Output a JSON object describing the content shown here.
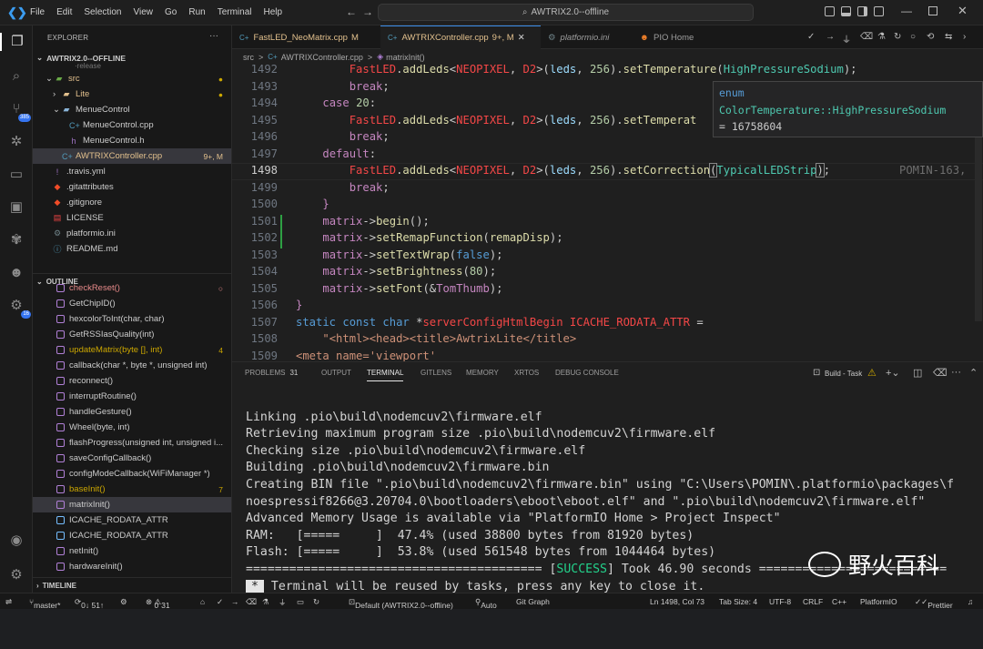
{
  "titlebar": {
    "menu": [
      "File",
      "Edit",
      "Selection",
      "View",
      "Go",
      "Run",
      "Terminal",
      "Help"
    ],
    "search": "AWTRIX2.0--offline"
  },
  "activity": {
    "scm_badge": "385",
    "ext_badge": "16"
  },
  "sidebar": {
    "explorer_title": "EXPLORER",
    "project": "AWTRIX2.0--OFFLINE",
    "items": [
      {
        "label": "src",
        "type": "folder",
        "dot": true
      },
      {
        "label": "Lite",
        "type": "folder",
        "dot": true
      },
      {
        "label": "MenueControl",
        "type": "folder"
      },
      {
        "label": "MenueControl.cpp",
        "type": "cpp"
      },
      {
        "label": "MenueControl.h",
        "type": "h"
      },
      {
        "label": "AWTRIXController.cpp",
        "type": "cpp",
        "decoration": "9+, M"
      },
      {
        "label": ".travis.yml",
        "type": "yml"
      },
      {
        "label": ".gitattributes",
        "type": "git"
      },
      {
        "label": ".gitignore",
        "type": "git"
      },
      {
        "label": "LICENSE",
        "type": "lic"
      },
      {
        "label": "platformio.ini",
        "type": "ini"
      },
      {
        "label": "README.md",
        "type": "md"
      }
    ],
    "outline_title": "OUTLINE",
    "outline": [
      {
        "label": "checkReset()",
        "decoration": "",
        "color": "#e88a8a"
      },
      {
        "label": "GetChipID()",
        "decoration": ""
      },
      {
        "label": "hexcolorToInt(char, char)",
        "decoration": ""
      },
      {
        "label": "GetRSSIasQuality(int)",
        "decoration": ""
      },
      {
        "label": "updateMatrix(byte [], int)",
        "decoration": "4",
        "color": "#cca700"
      },
      {
        "label": "callback(char *, byte *, unsigned int)",
        "decoration": ""
      },
      {
        "label": "reconnect()",
        "decoration": ""
      },
      {
        "label": "interruptRoutine()",
        "decoration": ""
      },
      {
        "label": "handleGesture()",
        "decoration": ""
      },
      {
        "label": "Wheel(byte, int)",
        "decoration": ""
      },
      {
        "label": "flashProgress(unsigned int, unsigned i...",
        "decoration": ""
      },
      {
        "label": "saveConfigCallback()",
        "decoration": ""
      },
      {
        "label": "configModeCallback(WiFiManager *)",
        "decoration": ""
      },
      {
        "label": "baseInit()",
        "decoration": "7",
        "color": "#cca700"
      },
      {
        "label": "matrixInit()",
        "decoration": "",
        "selected": true
      },
      {
        "label": "ICACHE_RODATA_ATTR",
        "decoration": "",
        "type": "const"
      },
      {
        "label": "ICACHE_RODATA_ATTR",
        "decoration": "",
        "type": "const"
      },
      {
        "label": "netInit()",
        "decoration": ""
      },
      {
        "label": "hardwareInit()",
        "decoration": ""
      }
    ],
    "timeline_title": "TIMELINE"
  },
  "tabs": [
    {
      "label": "FastLED_NeoMatrix.cpp",
      "mod": "M"
    },
    {
      "label": "AWTRIXController.cpp",
      "mod": "9+, M",
      "active": true
    },
    {
      "label": "platformio.ini",
      "mod": ""
    },
    {
      "label": "PIO Home",
      "mod": ""
    }
  ],
  "breadcrumb": [
    "src",
    ">",
    "AWTRIXController.cpp",
    ">",
    "matrixInit()"
  ],
  "editor": {
    "line_numbers": [
      "1492",
      "1493",
      "1494",
      "1495",
      "1496",
      "1497",
      "1498",
      "1499",
      "1500",
      "1501",
      "1502",
      "1503",
      "1504",
      "1505",
      "1506",
      "1507",
      "1508",
      "1509"
    ],
    "current_line": "1498",
    "inline_blame": "POMIN-163,",
    "hover": {
      "line1": "enum",
      "line2": "ColorTemperature::HighPressureSodium",
      "line3": "= 16758604"
    }
  },
  "panel": {
    "tabs": [
      "PROBLEMS",
      "OUTPUT",
      "TERMINAL",
      "GITLENS",
      "MEMORY",
      "XRTOS",
      "DEBUG CONSOLE"
    ],
    "problems_count": "31",
    "task_label": "Build - Task",
    "terminal_lines": [
      "Linking .pio\\build\\nodemcuv2\\firmware.elf",
      "Retrieving maximum program size .pio\\build\\nodemcuv2\\firmware.elf",
      "Checking size .pio\\build\\nodemcuv2\\firmware.elf",
      "Building .pio\\build\\nodemcuv2\\firmware.bin",
      "Creating BIN file \".pio\\build\\nodemcuv2\\firmware.bin\" using \"C:\\Users\\POMIN\\.platformio\\packages\\f",
      "noespressif8266@3.20704.0\\bootloaders\\eboot\\eboot.elf\" and \".pio\\build\\nodemcuv2\\firmware.elf\"",
      "Advanced Memory Usage is available via \"PlatformIO Home > Project Inspect\"",
      "RAM:   [=====     ]  47.4% (used 38800 bytes from 81920 bytes)",
      "Flash: [=====     ]  53.8% (used 561548 bytes from 1044464 bytes)"
    ],
    "success_prefix": "========================================= [",
    "success_word": "SUCCESS",
    "success_suffix": "] Took 46.90 seconds ==========================",
    "reuse_mark": "*",
    "reuse_text": "Terminal will be reused by tasks, press any key to close it."
  },
  "status": {
    "branch": "master*",
    "sync": "0↓ 51↑",
    "errors": "0",
    "warnings": "31",
    "env": "Default (AWTRIX2.0--offline)",
    "auto": "Auto",
    "gitgraph": "Git Graph",
    "position": "Ln 1498, Col 73",
    "tab": "Tab Size: 4",
    "enc": "UTF-8",
    "eol": "CRLF",
    "lang": "C++",
    "pio": "PlatformIO",
    "prettier": "Prettier"
  },
  "watermark": "野火百科"
}
